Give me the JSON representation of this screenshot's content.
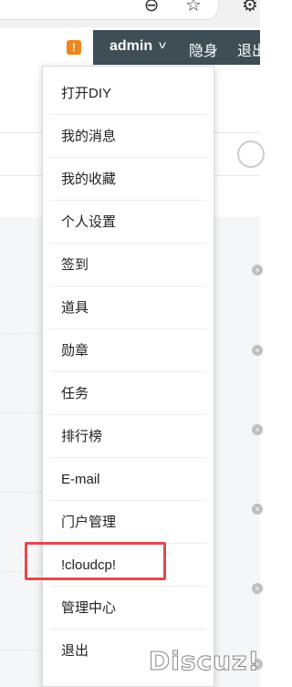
{
  "browser": {
    "icons": [
      "zoom-out-icon",
      "star-icon",
      "gear-icon"
    ]
  },
  "topnav": {
    "username": "admin",
    "invisible_label": "隐身",
    "logout_label": "退出",
    "colors": {
      "user_bar_bg": "#3f4e55",
      "notify": "#f0851d"
    }
  },
  "menu": {
    "items": [
      "打开DIY",
      "我的消息",
      "我的收藏",
      "个人设置",
      "签到",
      "道具",
      "勋章",
      "任务",
      "排行榜",
      "E-mail",
      "门户管理",
      "!cloudcp!",
      "管理中心",
      "退出"
    ],
    "highlighted_item": "!cloudcp!",
    "highlight_color": "#e5484d"
  },
  "watermark": "Discuz!"
}
